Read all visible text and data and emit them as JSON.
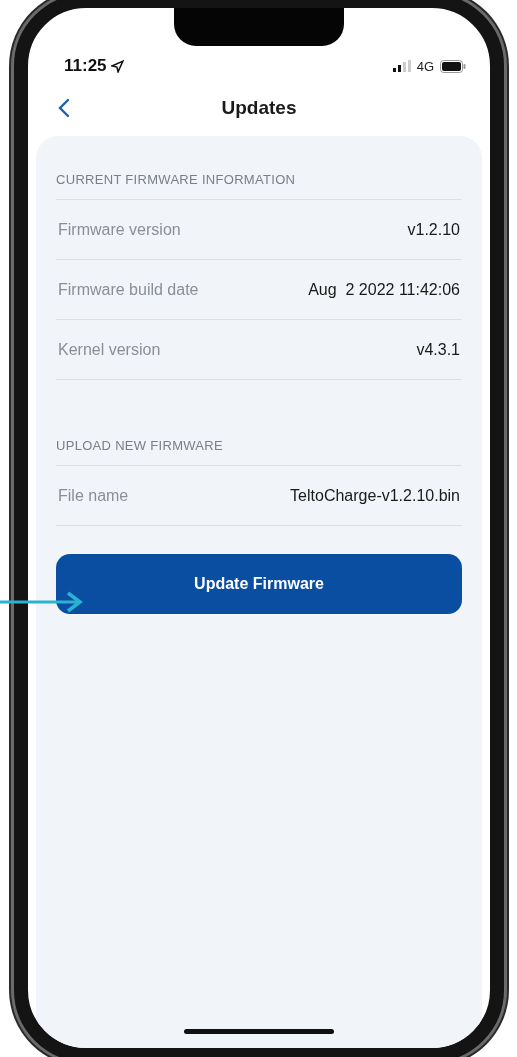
{
  "status_bar": {
    "time": "11:25",
    "network": "4G"
  },
  "nav": {
    "title": "Updates"
  },
  "sections": [
    {
      "heading": "CURRENT FIRMWARE INFORMATION",
      "rows": [
        {
          "label": "Firmware version",
          "value": "v1.2.10"
        },
        {
          "label": "Firmware build date",
          "value": "Aug  2 2022 11:42:06"
        },
        {
          "label": "Kernel version",
          "value": "v4.3.1"
        }
      ]
    },
    {
      "heading": "UPLOAD NEW FIRMWARE",
      "rows": [
        {
          "label": "File name",
          "value": "TeltoCharge-v1.2.10.bin"
        }
      ]
    }
  ],
  "button": {
    "label": "Update Firmware"
  }
}
